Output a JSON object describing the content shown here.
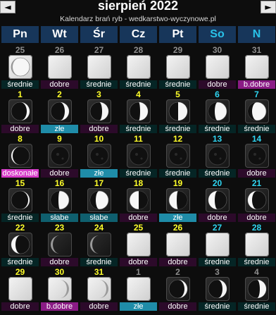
{
  "header": {
    "title": "sierpień 2022",
    "subtitle": "Kalendarz brań ryb - wedkarstwo-wyczynowe.pl",
    "prev_arrow": "◄",
    "next_arrow": "►"
  },
  "weekdays": [
    "Pn",
    "Wt",
    "Śr",
    "Cz",
    "Pt",
    "So",
    "N"
  ],
  "colors": {
    "header_bg": "#17365a",
    "weekday_text": "#ffffff",
    "weekend_text": "#29c2e8",
    "current_day_number": "#ffff2a",
    "weekend_day_number": "#2fd6f2",
    "other_month_day_number": "#8e8e8e",
    "dobre": "#2c0a2a",
    "srednie": "#052525",
    "zle": "#1f8ca8",
    "slabe": "#0f5f6e",
    "b.dobre": "#8a1b85",
    "doskonale": "#d63bc9"
  },
  "weeks": [
    [
      {
        "day": "25",
        "month": "prev",
        "rating": "średnie",
        "phase": "crescent-right-thin"
      },
      {
        "day": "26",
        "month": "prev",
        "rating": "dobre",
        "phase": "new-light"
      },
      {
        "day": "27",
        "month": "prev",
        "rating": "średnie",
        "phase": "new-light"
      },
      {
        "day": "28",
        "month": "prev",
        "rating": "średnie",
        "phase": "new-light"
      },
      {
        "day": "29",
        "month": "prev",
        "rating": "średnie",
        "phase": "new-light"
      },
      {
        "day": "30",
        "month": "prev",
        "rating": "dobre",
        "phase": "new-light"
      },
      {
        "day": "31",
        "month": "prev",
        "rating": "b.dobre",
        "phase": "new-light"
      }
    ],
    [
      {
        "day": "1",
        "month": "cur",
        "rating": "dobre",
        "phase": "waxing-crescent-small"
      },
      {
        "day": "2",
        "month": "cur",
        "rating": "złe",
        "phase": "waxing-crescent"
      },
      {
        "day": "3",
        "month": "cur",
        "rating": "dobre",
        "phase": "waxing-crescent-wide"
      },
      {
        "day": "4",
        "month": "cur",
        "rating": "średnie",
        "phase": "first-quarter-early"
      },
      {
        "day": "5",
        "month": "cur",
        "rating": "średnie",
        "phase": "first-quarter"
      },
      {
        "day": "6",
        "month": "cur",
        "rating": "średnie",
        "phase": "waxing-gibbous-early"
      },
      {
        "day": "7",
        "month": "cur",
        "rating": "średnie",
        "phase": "waxing-gibbous"
      }
    ],
    [
      {
        "day": "8",
        "month": "cur",
        "rating": "doskonałe",
        "phase": "gibbous-dark"
      },
      {
        "day": "9",
        "month": "cur",
        "rating": "dobre",
        "phase": "full-dark"
      },
      {
        "day": "10",
        "month": "cur",
        "rating": "złe",
        "phase": "full-dark"
      },
      {
        "day": "11",
        "month": "cur",
        "rating": "średnie",
        "phase": "full-dark"
      },
      {
        "day": "12",
        "month": "cur",
        "rating": "średnie",
        "phase": "full-dark"
      },
      {
        "day": "13",
        "month": "cur",
        "rating": "średnie",
        "phase": "full-dark"
      },
      {
        "day": "14",
        "month": "cur",
        "rating": "dobre",
        "phase": "full-dark"
      }
    ],
    [
      {
        "day": "15",
        "month": "cur",
        "rating": "średnie",
        "phase": "waning-gibbous-dark"
      },
      {
        "day": "16",
        "month": "cur",
        "rating": "słabe",
        "phase": "waning-gibbous"
      },
      {
        "day": "17",
        "month": "cur",
        "rating": "słabe",
        "phase": "waning-gibbous-light"
      },
      {
        "day": "18",
        "month": "cur",
        "rating": "dobre",
        "phase": "last-quarter"
      },
      {
        "day": "19",
        "month": "cur",
        "rating": "złe",
        "phase": "last-quarter-light"
      },
      {
        "day": "20",
        "month": "cur",
        "rating": "dobre",
        "phase": "waning-crescent-wide"
      },
      {
        "day": "21",
        "month": "cur",
        "rating": "dobre",
        "phase": "waning-crescent"
      }
    ],
    [
      {
        "day": "22",
        "month": "cur",
        "rating": "średnie",
        "phase": "waning-crescent"
      },
      {
        "day": "23",
        "month": "cur",
        "rating": "dobre",
        "phase": "waning-crescent-thin"
      },
      {
        "day": "24",
        "month": "cur",
        "rating": "średnie",
        "phase": "waning-crescent-thin"
      },
      {
        "day": "25",
        "month": "cur",
        "rating": "dobre",
        "phase": "new-light"
      },
      {
        "day": "26",
        "month": "cur",
        "rating": "dobre",
        "phase": "new-light"
      },
      {
        "day": "27",
        "month": "cur",
        "rating": "średnie",
        "phase": "new-light"
      },
      {
        "day": "28",
        "month": "cur",
        "rating": "średnie",
        "phase": "new-light"
      }
    ],
    [
      {
        "day": "29",
        "month": "cur",
        "rating": "dobre",
        "phase": "new-light"
      },
      {
        "day": "30",
        "month": "cur",
        "rating": "b.dobre",
        "phase": "waxing-crescent-thin"
      },
      {
        "day": "31",
        "month": "cur",
        "rating": "dobre",
        "phase": "waxing-crescent-thin"
      },
      {
        "day": "1",
        "month": "next",
        "rating": "złe",
        "phase": "new-light"
      },
      {
        "day": "2",
        "month": "next",
        "rating": "dobre",
        "phase": "waxing-crescent-small"
      },
      {
        "day": "3",
        "month": "next",
        "rating": "średnie",
        "phase": "waxing-crescent"
      },
      {
        "day": "4",
        "month": "next",
        "rating": "średnie",
        "phase": "waxing-crescent-wide"
      }
    ]
  ]
}
